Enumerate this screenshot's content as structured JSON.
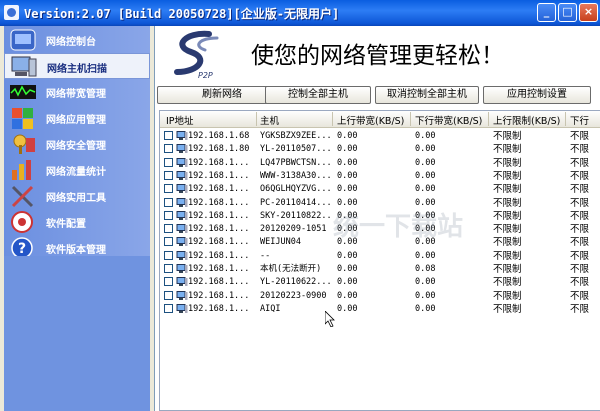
{
  "window": {
    "title": "Version:2.07 [Build 20050728][企业版-无限用户]",
    "controls": {
      "minimize": "_",
      "maximize": "□",
      "close": "×"
    }
  },
  "sidebar": {
    "items": [
      {
        "label": "网络控制台",
        "icon": "console-icon"
      },
      {
        "label": "网络主机扫描",
        "icon": "computer-scan-icon"
      },
      {
        "label": "网络带宽管理",
        "icon": "bandwidth-icon"
      },
      {
        "label": "网络应用管理",
        "icon": "app-manage-icon"
      },
      {
        "label": "网络安全管理",
        "icon": "security-icon"
      },
      {
        "label": "网络流量统计",
        "icon": "traffic-stats-icon"
      },
      {
        "label": "网络实用工具",
        "icon": "tools-icon"
      },
      {
        "label": "软件配置",
        "icon": "config-icon"
      },
      {
        "label": "软件版本管理",
        "icon": "help-icon"
      }
    ]
  },
  "banner": {
    "slogan": "使您的网络管理更轻松！",
    "logo_text": "P2P"
  },
  "toolbar": {
    "refresh": "刷新网络",
    "control_all": "控制全部主机",
    "cancel_all": "取消控制全部主机",
    "apply": "应用控制设置"
  },
  "table": {
    "columns": [
      "IP地址",
      "主机",
      "上行带宽(KB/S)",
      "下行带宽(KB/S)",
      "上行限制(KB/S)",
      "下行"
    ],
    "rows": [
      {
        "ip": "192.168.1.68",
        "host": "YGKSBZX9ZEE...",
        "up": "0.00",
        "down": "0.00",
        "uplimit": "不限制",
        "downlimit": "不限"
      },
      {
        "ip": "192.168.1.80",
        "host": "YL-20110507...",
        "up": "0.00",
        "down": "0.00",
        "uplimit": "不限制",
        "downlimit": "不限"
      },
      {
        "ip": "192.168.1...",
        "host": "LQ47PBWCTSN...",
        "up": "0.00",
        "down": "0.00",
        "uplimit": "不限制",
        "downlimit": "不限"
      },
      {
        "ip": "192.168.1...",
        "host": "WWW-3138A30...",
        "up": "0.00",
        "down": "0.00",
        "uplimit": "不限制",
        "downlimit": "不限"
      },
      {
        "ip": "192.168.1...",
        "host": "O6QGLHQYZVG...",
        "up": "0.00",
        "down": "0.00",
        "uplimit": "不限制",
        "downlimit": "不限"
      },
      {
        "ip": "192.168.1...",
        "host": "PC-20110414...",
        "up": "0.00",
        "down": "0.00",
        "uplimit": "不限制",
        "downlimit": "不限"
      },
      {
        "ip": "192.168.1...",
        "host": "SKY-20110822...",
        "up": "0.00",
        "down": "0.00",
        "uplimit": "不限制",
        "downlimit": "不限"
      },
      {
        "ip": "192.168.1...",
        "host": "20120209-1051",
        "up": "0.00",
        "down": "0.00",
        "uplimit": "不限制",
        "downlimit": "不限"
      },
      {
        "ip": "192.168.1...",
        "host": "WEIJUN04",
        "up": "0.00",
        "down": "0.00",
        "uplimit": "不限制",
        "downlimit": "不限"
      },
      {
        "ip": "192.168.1...",
        "host": "--",
        "up": "0.00",
        "down": "0.00",
        "uplimit": "不限制",
        "downlimit": "不限"
      },
      {
        "ip": "192.168.1...",
        "host": "本机(无法断开)",
        "up": "0.00",
        "down": "0.08",
        "uplimit": "不限制",
        "downlimit": "不限"
      },
      {
        "ip": "192.168.1...",
        "host": "YL-20110622...",
        "up": "0.00",
        "down": "0.00",
        "uplimit": "不限制",
        "downlimit": "不限"
      },
      {
        "ip": "192.168.1...",
        "host": "20120223-0900",
        "up": "0.00",
        "down": "0.00",
        "uplimit": "不限制",
        "downlimit": "不限"
      },
      {
        "ip": "192.168.1...",
        "host": "AIQI",
        "up": "0.00",
        "down": "0.00",
        "uplimit": "不限制",
        "downlimit": "不限"
      }
    ]
  },
  "watermark": "统一下载站",
  "colors": {
    "titlebar": "#0a5ee0",
    "sidebar": "#6b8fe0",
    "active_item": "#eef2fa"
  }
}
